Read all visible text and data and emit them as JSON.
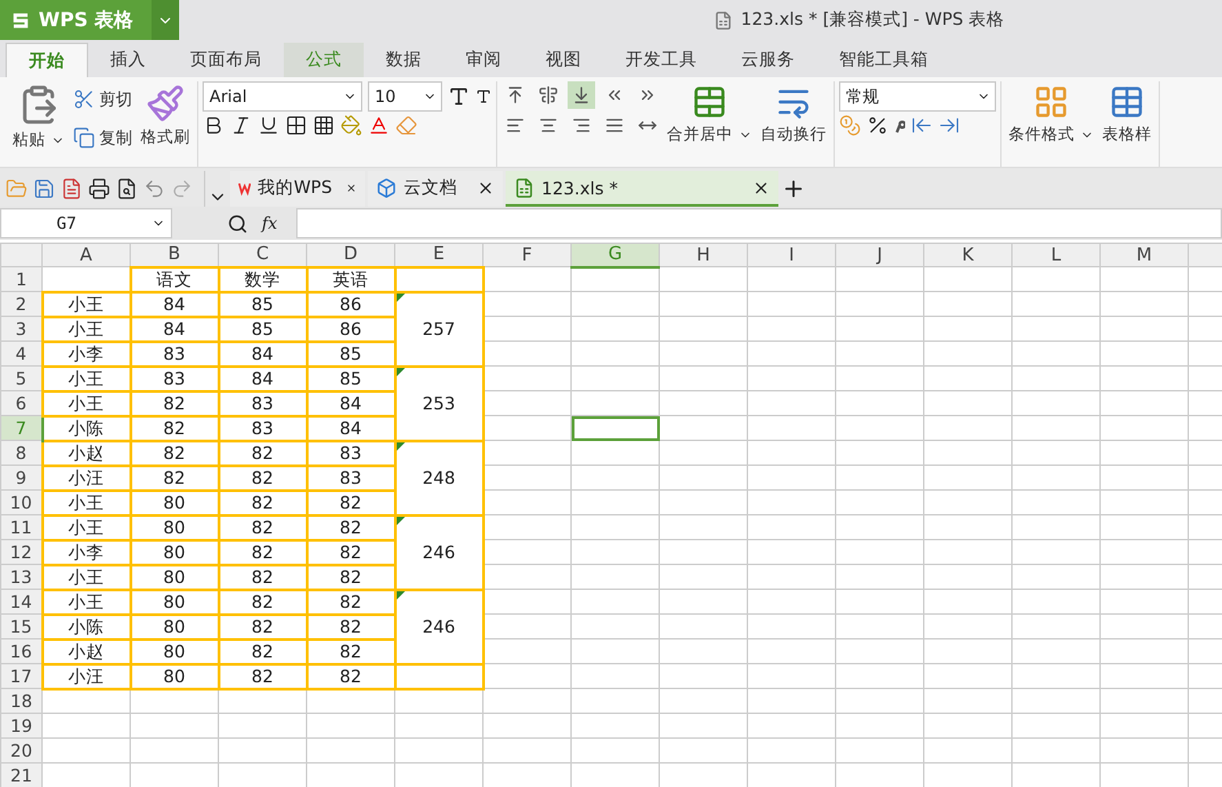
{
  "app_button": {
    "label": "WPS 表格"
  },
  "window": {
    "title": "123.xls * [兼容模式] - WPS 表格"
  },
  "tabs": [
    {
      "label": "开始",
      "selected": true,
      "hovered": false
    },
    {
      "label": "插入",
      "selected": false,
      "hovered": false
    },
    {
      "label": "页面布局",
      "selected": false,
      "hovered": false
    },
    {
      "label": "公式",
      "selected": false,
      "hovered": true
    },
    {
      "label": "数据",
      "selected": false,
      "hovered": false
    },
    {
      "label": "审阅",
      "selected": false,
      "hovered": false
    },
    {
      "label": "视图",
      "selected": false,
      "hovered": false
    },
    {
      "label": "开发工具",
      "selected": false,
      "hovered": false
    },
    {
      "label": "云服务",
      "selected": false,
      "hovered": false
    },
    {
      "label": "智能工具箱",
      "selected": false,
      "hovered": false
    }
  ],
  "ribbon": {
    "paste": "粘贴",
    "cut": "剪切",
    "copy": "复制",
    "format_painter": "格式刷",
    "font": "Arial",
    "font_size": "10",
    "align_buttons": [
      {
        "selected": false
      },
      {
        "selected": false
      },
      {
        "selected": true
      },
      {
        "selected": false
      },
      {
        "selected": false
      },
      {
        "selected": false
      },
      {
        "selected": false
      },
      {
        "selected": false
      },
      {
        "selected": false
      },
      {
        "selected": false
      }
    ],
    "merge": "合并居中",
    "wrap": "自动换行",
    "number_format": "常规",
    "conditional": "条件格式",
    "table_style": "表格样"
  },
  "doc_tabs": [
    {
      "label": "我的WPS",
      "kind": "wps",
      "selected": false
    },
    {
      "label": "云文档",
      "kind": "cloud",
      "selected": false
    },
    {
      "label": "123.xls *",
      "kind": "sheet",
      "selected": true
    }
  ],
  "formula_bar": {
    "name_box": "G7",
    "fx_label": "fx"
  },
  "sheet": {
    "columns": [
      {
        "label": "A",
        "selected": false
      },
      {
        "label": "B",
        "selected": false
      },
      {
        "label": "C",
        "selected": false
      },
      {
        "label": "D",
        "selected": false
      },
      {
        "label": "E",
        "selected": false
      },
      {
        "label": "F",
        "selected": false
      },
      {
        "label": "G",
        "selected": true
      },
      {
        "label": "H",
        "selected": false
      },
      {
        "label": "I",
        "selected": false
      },
      {
        "label": "J",
        "selected": false
      },
      {
        "label": "K",
        "selected": false
      },
      {
        "label": "L",
        "selected": false
      },
      {
        "label": "M",
        "selected": false
      }
    ],
    "header_row": {
      "label": "1",
      "selected": false,
      "titles": [
        "语文",
        "数学",
        "英语"
      ]
    },
    "groups": [
      {
        "total": "257",
        "rows": [
          {
            "label": "2",
            "selected": false,
            "name": "小王",
            "scores": [
              "84",
              "85",
              "86"
            ]
          },
          {
            "label": "3",
            "selected": false,
            "name": "小王",
            "scores": [
              "84",
              "85",
              "86"
            ]
          },
          {
            "label": "4",
            "selected": false,
            "name": "小李",
            "scores": [
              "83",
              "84",
              "85"
            ]
          }
        ]
      },
      {
        "total": "253",
        "rows": [
          {
            "label": "5",
            "selected": false,
            "name": "小王",
            "scores": [
              "83",
              "84",
              "85"
            ]
          },
          {
            "label": "6",
            "selected": false,
            "name": "小王",
            "scores": [
              "82",
              "83",
              "84"
            ]
          },
          {
            "label": "7",
            "selected": true,
            "name": "小陈",
            "scores": [
              "82",
              "83",
              "84"
            ]
          }
        ]
      },
      {
        "total": "248",
        "rows": [
          {
            "label": "8",
            "selected": false,
            "name": "小赵",
            "scores": [
              "82",
              "82",
              "83"
            ]
          },
          {
            "label": "9",
            "selected": false,
            "name": "小汪",
            "scores": [
              "82",
              "82",
              "83"
            ]
          },
          {
            "label": "10",
            "selected": false,
            "name": "小王",
            "scores": [
              "80",
              "82",
              "82"
            ]
          }
        ]
      },
      {
        "total": "246",
        "rows": [
          {
            "label": "11",
            "selected": false,
            "name": "小王",
            "scores": [
              "80",
              "82",
              "82"
            ]
          },
          {
            "label": "12",
            "selected": false,
            "name": "小李",
            "scores": [
              "80",
              "82",
              "82"
            ]
          },
          {
            "label": "13",
            "selected": false,
            "name": "小王",
            "scores": [
              "80",
              "82",
              "82"
            ]
          }
        ]
      },
      {
        "total": "246",
        "rows": [
          {
            "label": "14",
            "selected": false,
            "name": "小王",
            "scores": [
              "80",
              "82",
              "82"
            ]
          },
          {
            "label": "15",
            "selected": false,
            "name": "小陈",
            "scores": [
              "80",
              "82",
              "82"
            ]
          },
          {
            "label": "16",
            "selected": false,
            "name": "小赵",
            "scores": [
              "80",
              "82",
              "82"
            ]
          }
        ]
      },
      {
        "rows": [
          {
            "label": "17",
            "selected": false,
            "name": "小汪",
            "scores": [
              "80",
              "82",
              "82"
            ]
          }
        ]
      }
    ],
    "empty_rows": [
      {
        "label": "18",
        "selected": false
      },
      {
        "label": "19",
        "selected": false
      },
      {
        "label": "20",
        "selected": false
      },
      {
        "label": "21",
        "selected": false
      }
    ]
  }
}
